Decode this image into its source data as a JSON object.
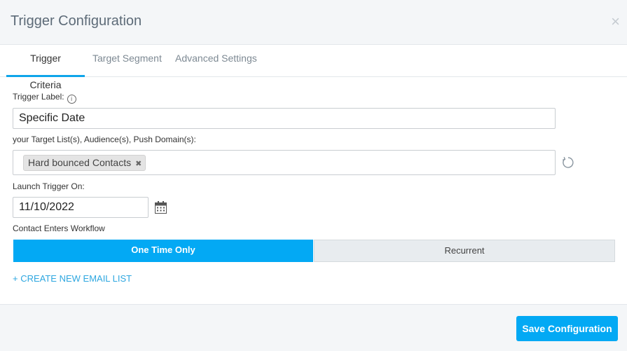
{
  "header": {
    "title": "Trigger Configuration",
    "close_symbol": "×",
    "close_icon": "close-icon"
  },
  "tabs": [
    {
      "label": "Trigger Criteria",
      "active": true
    },
    {
      "label": "Target Segment",
      "active": false
    },
    {
      "label": "Advanced Settings",
      "active": false
    }
  ],
  "form": {
    "trigger_label": {
      "label": "Trigger Label:",
      "info_symbol": "i",
      "value": "Specific Date"
    },
    "target_lists": {
      "label": "your Target List(s), Audience(s), Push Domain(s):",
      "tags": [
        {
          "label": "Hard bounced Contacts",
          "remove_symbol": "✖"
        }
      ]
    },
    "launch_on": {
      "label": "Launch Trigger On:",
      "value": "11/10/2022"
    },
    "contact_enters": {
      "label": "Contact Enters Workflow",
      "options": [
        "One Time Only",
        "Recurrent"
      ],
      "selected": "One Time Only"
    },
    "create_list_link": "+ CREATE NEW EMAIL LIST"
  },
  "footer": {
    "save_label": "Save Configuration"
  },
  "colors": {
    "accent": "#03a9f4",
    "link": "#2ea7e0",
    "header_bg": "#f4f6f8"
  }
}
